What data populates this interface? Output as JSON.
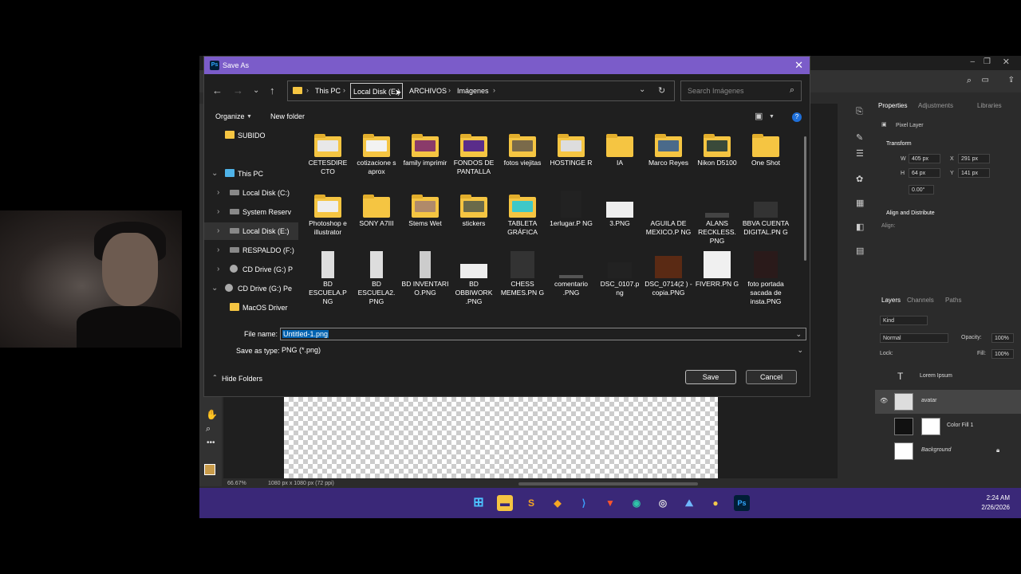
{
  "dialog": {
    "title": "Save As",
    "breadcrumbs": [
      "This PC",
      "Local Disk (E:)",
      "ARCHIVOS",
      "Imágenes"
    ],
    "search_placeholder": "Search Imágenes",
    "organize_label": "Organize",
    "new_folder_label": "New folder",
    "nav_items": [
      {
        "label": "SUBIDO",
        "icon": "folder-icon"
      },
      {
        "label": "This PC",
        "icon": "pc-icon"
      },
      {
        "label": "Local Disk (C:)",
        "icon": "drive-icon"
      },
      {
        "label": "System Reserv",
        "icon": "drive-icon"
      },
      {
        "label": "Local Disk (E:)",
        "icon": "drive-icon"
      },
      {
        "label": "RESPALDO (F:)",
        "icon": "drive-icon"
      },
      {
        "label": "CD Drive (G:) P",
        "icon": "cd-icon"
      },
      {
        "label": "CD Drive (G:) Pe",
        "icon": "cd-icon"
      },
      {
        "label": "MacOS Driver",
        "icon": "folder-icon"
      }
    ],
    "files": [
      {
        "name": "CETESDIRECTO",
        "label": "CETESDIRE CTO",
        "kind": "folder"
      },
      {
        "name": "cotizaciones aprox",
        "label": "cotizacione s aprox",
        "kind": "folder"
      },
      {
        "name": "family imprimir",
        "label": "family imprimir",
        "kind": "folder"
      },
      {
        "name": "FONDOS DE PANTALLA",
        "label": "FONDOS DE PANTALLA",
        "kind": "folder"
      },
      {
        "name": "fotos viejitas",
        "label": "fotos viejitas",
        "kind": "folder"
      },
      {
        "name": "HOSTINGER",
        "label": "HOSTINGE R",
        "kind": "folder"
      },
      {
        "name": "IA",
        "label": "IA",
        "kind": "folder"
      },
      {
        "name": "Marco Reyes",
        "label": "Marco Reyes",
        "kind": "folder"
      },
      {
        "name": "Nikon D5100",
        "label": "Nikon D5100",
        "kind": "folder"
      },
      {
        "name": "One Shot",
        "label": "One Shot",
        "kind": "folder"
      },
      {
        "name": "Photoshope illustrator",
        "label": "Photoshop e illustrator",
        "kind": "folder"
      },
      {
        "name": "SONY A7III",
        "label": "SONY A7III",
        "kind": "folder"
      },
      {
        "name": "Stems Wet",
        "label": "Stems Wet",
        "kind": "folder"
      },
      {
        "name": "stickers",
        "label": "stickers",
        "kind": "folder"
      },
      {
        "name": "TABLETA GRÁFICA",
        "label": "TABLETA GRÁFICA",
        "kind": "folder"
      },
      {
        "name": "1erlugar.PNG",
        "label": "1erlugar.P NG",
        "kind": "image"
      },
      {
        "name": "3.PNG",
        "label": "3.PNG",
        "kind": "image"
      },
      {
        "name": "AGUILA DE MEXICO.PNG",
        "label": "AGUILA DE MEXICO.P NG",
        "kind": "image"
      },
      {
        "name": "ALANS RECKLESS.PNG",
        "label": "ALANS RECKLESS. PNG",
        "kind": "image"
      },
      {
        "name": "BBVA CUENTA DIGITAL.PNG",
        "label": "BBVA CUENTA DIGITAL.PN G",
        "kind": "image"
      },
      {
        "name": "BD ESCUELA.PNG",
        "label": "BD ESCUELA.P NG",
        "kind": "image"
      },
      {
        "name": "BD ESCUELA2.PNG",
        "label": "BD ESCUELA2. PNG",
        "kind": "image"
      },
      {
        "name": "BD INVENTARIO.PNG",
        "label": "BD INVENTARI O.PNG",
        "kind": "image"
      },
      {
        "name": "BD OBBIWORK.PNG",
        "label": "BD OBBIWORK .PNG",
        "kind": "image"
      },
      {
        "name": "CHESS MEMES.PNG",
        "label": "CHESS MEMES.PN G",
        "kind": "image"
      },
      {
        "name": "comentario.PNG",
        "label": "comentario .PNG",
        "kind": "image"
      },
      {
        "name": "DSC_0107.png",
        "label": "DSC_0107.p ng",
        "kind": "image"
      },
      {
        "name": "DSC_0714(2) - copia.PNG",
        "label": "DSC_0714(2 ) - copia.PNG",
        "kind": "image"
      },
      {
        "name": "FIVERR.PNG",
        "label": "FIVERR.PN G",
        "kind": "image"
      },
      {
        "name": "foto portada sacada de insta.PNG",
        "label": "foto portada sacada de insta.PNG",
        "kind": "image"
      }
    ],
    "file_name_label": "File name:",
    "file_name_value": "Untitled-1.png",
    "save_type_label": "Save as type:",
    "save_type_value": "PNG (*.png)",
    "hide_folders_label": "Hide Folders",
    "save_label": "Save",
    "cancel_label": "Cancel"
  },
  "photoshop": {
    "tabs": [
      "Properties",
      "Adjustments",
      "Libraries"
    ],
    "pixel_layer": "Pixel Layer",
    "transform_label": "Transform",
    "w_label": "W",
    "w_value": "405 px",
    "x_label": "X",
    "x_value": "291 px",
    "h_label": "H",
    "h_value": "64 px",
    "y_label": "Y",
    "y_value": "141 px",
    "angle_value": "0.00°",
    "align_label": "Align and Distribute",
    "align_sub": "Align:",
    "layers_tabs": [
      "Layers",
      "Channels",
      "Paths"
    ],
    "kind_label": "Kind",
    "blend_mode": "Normal",
    "opacity_label": "Opacity:",
    "opacity_value": "100%",
    "lock_label": "Lock:",
    "fill_label": "Fill:",
    "fill_value": "100%",
    "layers": [
      {
        "name": "Lorem Ipsum"
      },
      {
        "name": "avatar"
      },
      {
        "name": "Color Fill 1"
      },
      {
        "name": "Background"
      }
    ],
    "zoom": "66.67%",
    "doc_info": "1080 px x 1080 px (72 ppi)"
  },
  "taskbar": {
    "time": "2:24 AM",
    "date": "2/26/2026"
  },
  "colors": {
    "title_bar": "#7b5cc9",
    "taskbar": "#3a2878",
    "folder": "#f5c542",
    "selection": "#0063b1"
  }
}
